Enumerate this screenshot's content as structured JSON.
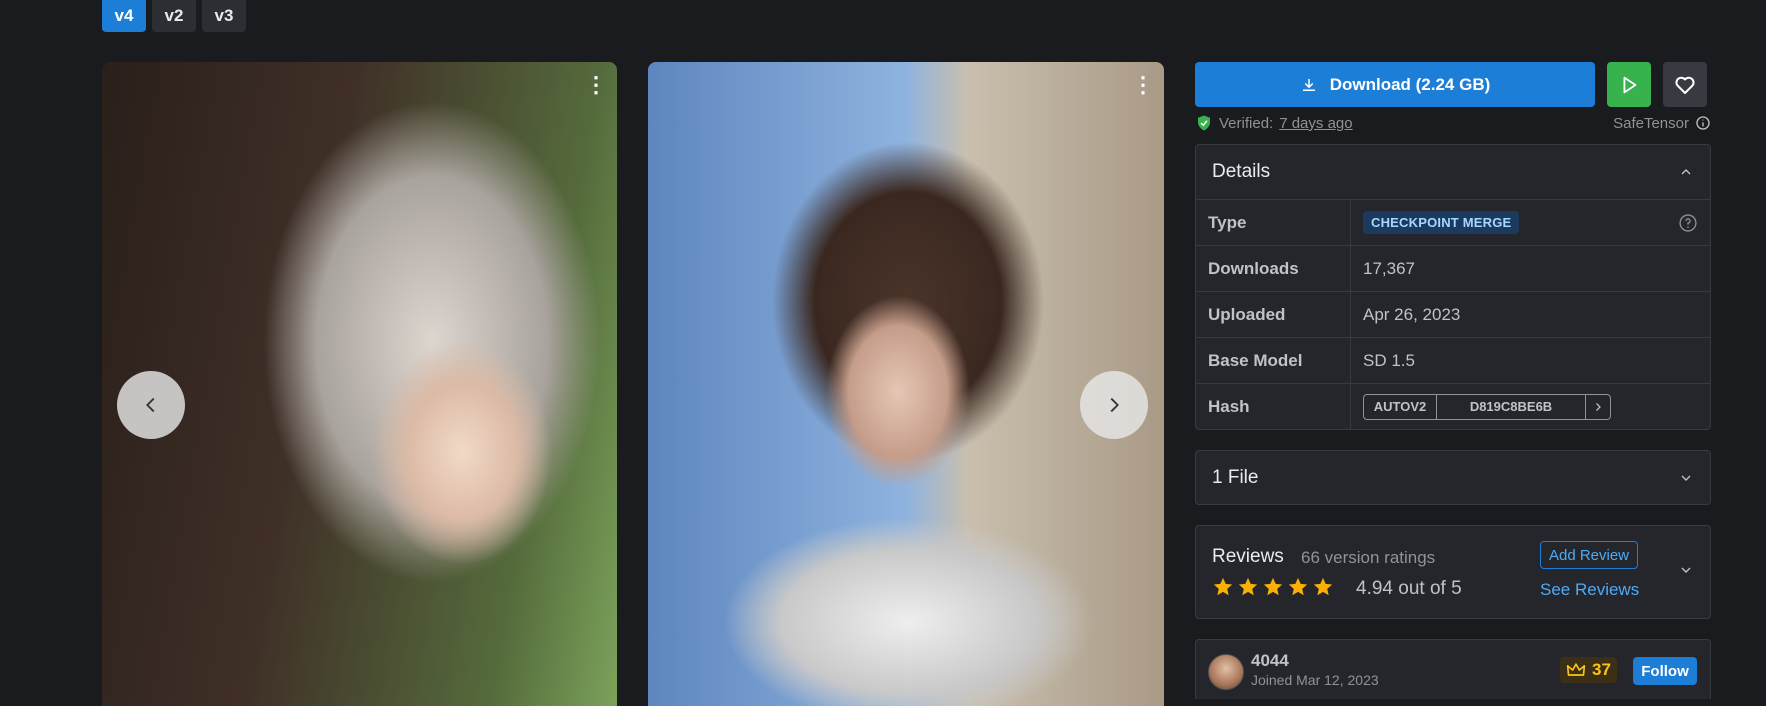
{
  "versions": [
    "v4",
    "v2",
    "v3"
  ],
  "download": {
    "label": "Download (2.24 GB)"
  },
  "verified": {
    "prefix": "Verified:",
    "when": "7 days ago",
    "format": "SafeTensor"
  },
  "details": {
    "title": "Details",
    "type_label": "Type",
    "type_value": "CHECKPOINT MERGE",
    "downloads_label": "Downloads",
    "downloads_value": "17,367",
    "uploaded_label": "Uploaded",
    "uploaded_value": "Apr 26, 2023",
    "base_model_label": "Base Model",
    "base_model_value": "SD 1.5",
    "hash_label": "Hash",
    "hash_type": "AUTOV2",
    "hash_value": "D819C8BE6B"
  },
  "files": {
    "title": "1 File"
  },
  "reviews": {
    "title": "Reviews",
    "count": "66 version ratings",
    "average": "4.94 out of 5",
    "rating": 4.94,
    "add_label": "Add Review",
    "see_label": "See Reviews"
  },
  "creator": {
    "name": "4044",
    "joined": "Joined Mar 12, 2023",
    "crown_count": "37",
    "follow_label": "Follow"
  },
  "colors": {
    "accent": "#1c7ed6",
    "run": "#37b24d",
    "star": "#fab005",
    "background": "#1a1b1e",
    "panel": "#25262b"
  }
}
